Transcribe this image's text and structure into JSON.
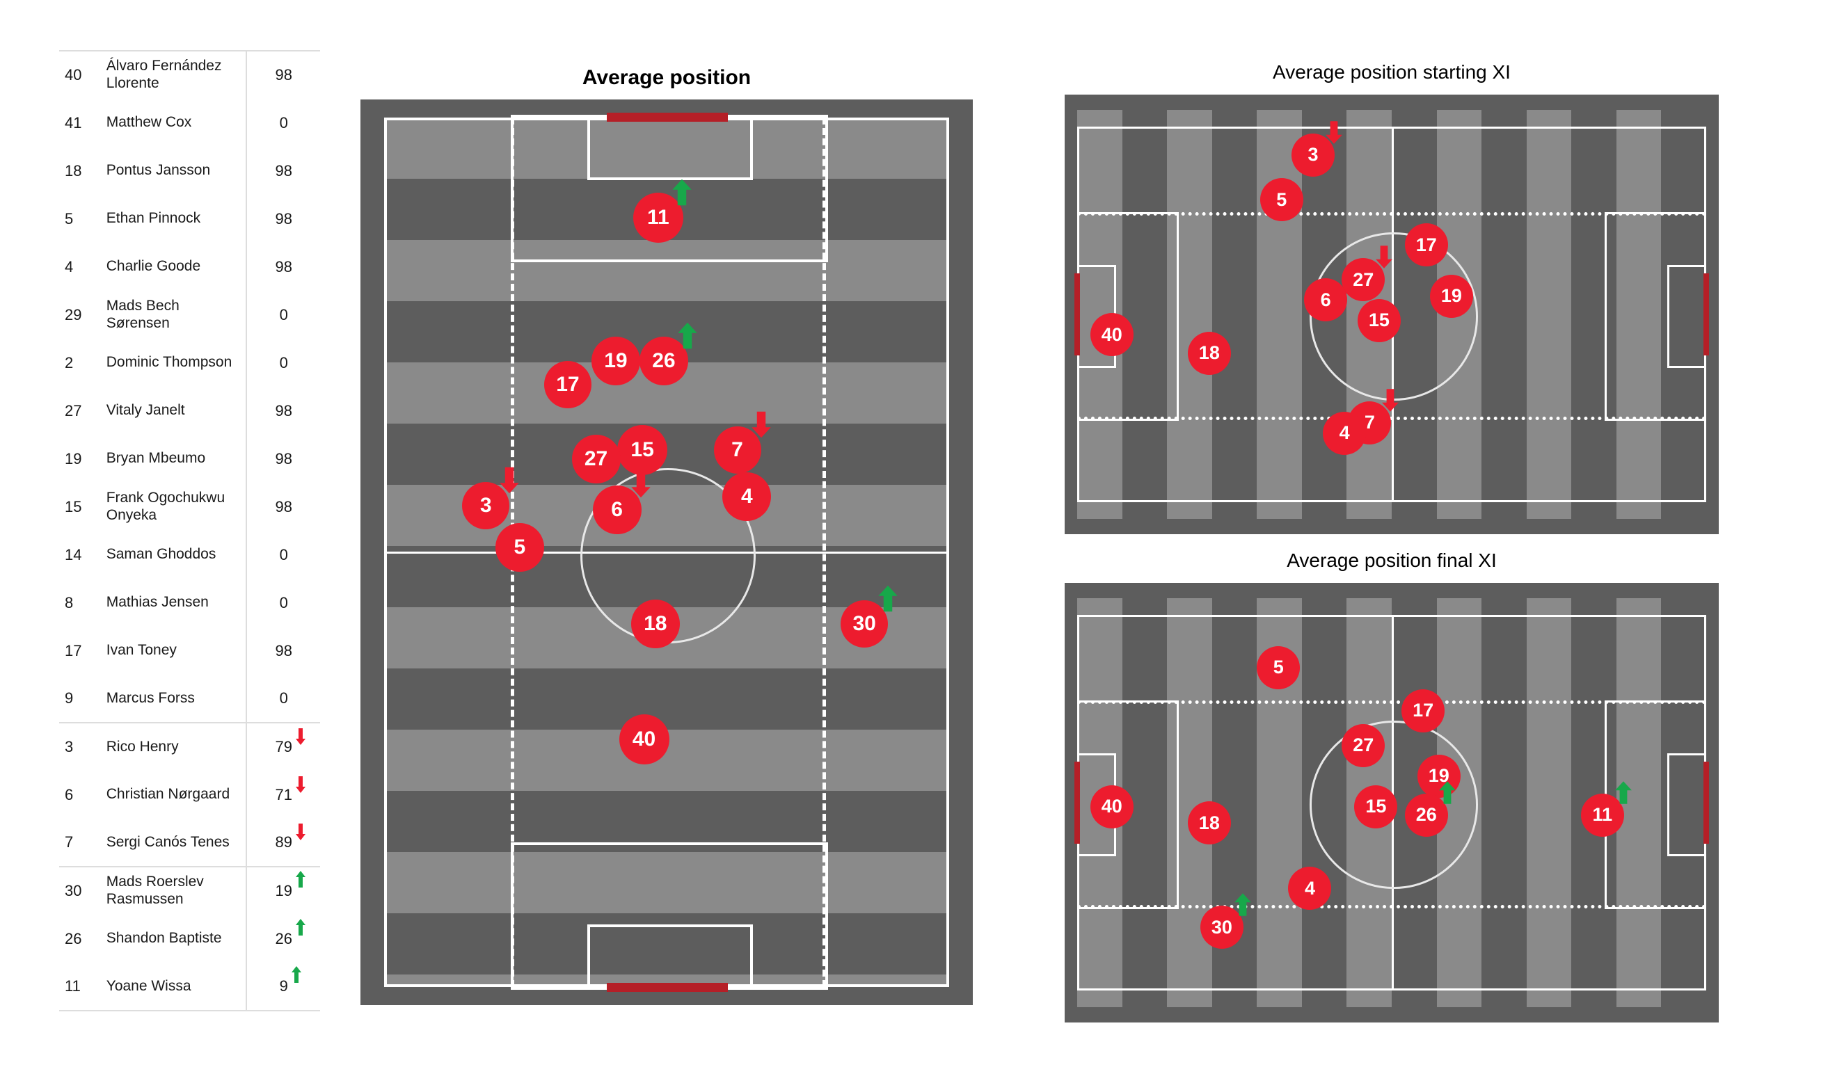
{
  "roster": {
    "columns": [
      "number",
      "player",
      "minutes"
    ],
    "groups": [
      {
        "group": "starters-and-bench",
        "rows": [
          {
            "number": "40",
            "player": "Álvaro Fernández Llorente",
            "value": "98",
            "sub": "none"
          },
          {
            "number": "41",
            "player": "Matthew Cox",
            "value": "0",
            "sub": "none"
          },
          {
            "number": "18",
            "player": "Pontus Jansson",
            "value": "98",
            "sub": "none"
          },
          {
            "number": "5",
            "player": "Ethan Pinnock",
            "value": "98",
            "sub": "none"
          },
          {
            "number": "4",
            "player": "Charlie Goode",
            "value": "98",
            "sub": "none"
          },
          {
            "number": "29",
            "player": "Mads Bech Sørensen",
            "value": "0",
            "sub": "none"
          },
          {
            "number": "2",
            "player": "Dominic Thompson",
            "value": "0",
            "sub": "none"
          },
          {
            "number": "27",
            "player": "Vitaly Janelt",
            "value": "98",
            "sub": "none"
          },
          {
            "number": "19",
            "player": "Bryan Mbeumo",
            "value": "98",
            "sub": "none"
          },
          {
            "number": "15",
            "player": "Frank Ogochukwu Onyeka",
            "value": "98",
            "sub": "none"
          },
          {
            "number": "14",
            "player": "Saman Ghoddos",
            "value": "0",
            "sub": "none"
          },
          {
            "number": "8",
            "player": "Mathias Jensen",
            "value": "0",
            "sub": "none"
          },
          {
            "number": "17",
            "player": "Ivan Toney",
            "value": "98",
            "sub": "none"
          },
          {
            "number": "9",
            "player": "Marcus Forss",
            "value": "0",
            "sub": "none"
          }
        ]
      },
      {
        "group": "subbed-off",
        "rows": [
          {
            "number": "3",
            "player": "Rico Henry",
            "value": "79",
            "sub": "down"
          },
          {
            "number": "6",
            "player": "Christian Nørgaard",
            "value": "71",
            "sub": "down"
          },
          {
            "number": "7",
            "player": "Sergi Canós Tenes",
            "value": "89",
            "sub": "down"
          }
        ]
      },
      {
        "group": "subbed-on",
        "rows": [
          {
            "number": "30",
            "player": "Mads Roerslev Rasmussen",
            "value": "19",
            "sub": "up"
          },
          {
            "number": "26",
            "player": "Shandon Baptiste",
            "value": "26",
            "sub": "up"
          },
          {
            "number": "11",
            "player": "Yoane Wissa",
            "value": "9",
            "sub": "up"
          }
        ]
      }
    ]
  },
  "panels": {
    "main": {
      "title": "Average position"
    },
    "starting": {
      "title": "Average position starting XI"
    },
    "final": {
      "title": "Average position final XI"
    }
  },
  "colors": {
    "marker_red": "#ED1C2E",
    "arrow_green": "#17A84A",
    "arrow_red": "#ED1C2E",
    "goal_red": "#b51f27",
    "pitch_light": "#8a8a8a",
    "pitch_dark": "#5d5d5d",
    "pitch_border": "#5d5d5d",
    "line_white": "#ffffff",
    "table_rule": "#dddddd"
  },
  "chart_data": {
    "type": "scatter",
    "title": "Average position",
    "description": "Football average-position maps. Marker x/y are percentages of the pitch turf area; r is marker radius in px.",
    "pitches": [
      {
        "id": "main",
        "title": "Average position",
        "orientation": "vertical",
        "markers": [
          {
            "number": "11",
            "x": 48.5,
            "y": 11.5,
            "r": 36,
            "arrow": "up"
          },
          {
            "number": "19",
            "x": 41.0,
            "y": 28.0,
            "r": 35,
            "arrow": "none"
          },
          {
            "number": "26",
            "x": 49.5,
            "y": 28.0,
            "r": 35,
            "arrow": "up"
          },
          {
            "number": "17",
            "x": 32.5,
            "y": 30.7,
            "r": 34,
            "arrow": "none"
          },
          {
            "number": "15",
            "x": 45.7,
            "y": 38.2,
            "r": 36,
            "arrow": "none"
          },
          {
            "number": "27",
            "x": 37.5,
            "y": 39.3,
            "r": 35,
            "arrow": "none"
          },
          {
            "number": "7",
            "x": 62.5,
            "y": 38.2,
            "r": 34,
            "arrow": "down"
          },
          {
            "number": "4",
            "x": 64.2,
            "y": 43.6,
            "r": 35,
            "arrow": "none"
          },
          {
            "number": "6",
            "x": 41.2,
            "y": 45.1,
            "r": 35,
            "arrow": "down"
          },
          {
            "number": "3",
            "x": 18.0,
            "y": 44.6,
            "r": 34,
            "arrow": "down"
          },
          {
            "number": "5",
            "x": 24.0,
            "y": 49.4,
            "r": 35,
            "arrow": "none"
          },
          {
            "number": "18",
            "x": 48.0,
            "y": 58.2,
            "r": 35,
            "arrow": "none"
          },
          {
            "number": "30",
            "x": 85.0,
            "y": 58.2,
            "r": 34,
            "arrow": "up"
          },
          {
            "number": "40",
            "x": 46.0,
            "y": 71.5,
            "r": 36,
            "arrow": "none"
          }
        ]
      },
      {
        "id": "starting",
        "title": "Average position starting XI",
        "orientation": "horizontal",
        "markers": [
          {
            "number": "3",
            "x": 37.5,
            "y": 11.0,
            "r": 31,
            "arrow": "down"
          },
          {
            "number": "5",
            "x": 32.5,
            "y": 22.0,
            "r": 31,
            "arrow": "none"
          },
          {
            "number": "17",
            "x": 55.5,
            "y": 33.0,
            "r": 31,
            "arrow": "none"
          },
          {
            "number": "27",
            "x": 45.5,
            "y": 41.5,
            "r": 31,
            "arrow": "down"
          },
          {
            "number": "19",
            "x": 59.5,
            "y": 45.5,
            "r": 31,
            "arrow": "none"
          },
          {
            "number": "6",
            "x": 39.5,
            "y": 46.5,
            "r": 31,
            "arrow": "none"
          },
          {
            "number": "15",
            "x": 48.0,
            "y": 51.5,
            "r": 31,
            "arrow": "none"
          },
          {
            "number": "40",
            "x": 5.5,
            "y": 55.0,
            "r": 31,
            "arrow": "none"
          },
          {
            "number": "18",
            "x": 21.0,
            "y": 59.5,
            "r": 31,
            "arrow": "none"
          },
          {
            "number": "7",
            "x": 46.5,
            "y": 76.5,
            "r": 31,
            "arrow": "down"
          },
          {
            "number": "4",
            "x": 42.5,
            "y": 79.0,
            "r": 31,
            "arrow": "none"
          }
        ]
      },
      {
        "id": "final",
        "title": "Average position final XI",
        "orientation": "horizontal",
        "markers": [
          {
            "number": "5",
            "x": 32.0,
            "y": 17.0,
            "r": 31,
            "arrow": "none"
          },
          {
            "number": "17",
            "x": 55.0,
            "y": 27.5,
            "r": 31,
            "arrow": "none"
          },
          {
            "number": "27",
            "x": 45.5,
            "y": 36.0,
            "r": 31,
            "arrow": "none"
          },
          {
            "number": "19",
            "x": 57.5,
            "y": 43.5,
            "r": 31,
            "arrow": "none"
          },
          {
            "number": "15",
            "x": 47.5,
            "y": 51.0,
            "r": 31,
            "arrow": "none"
          },
          {
            "number": "26",
            "x": 55.5,
            "y": 53.0,
            "r": 31,
            "arrow": "up"
          },
          {
            "number": "40",
            "x": 5.5,
            "y": 51.0,
            "r": 31,
            "arrow": "none"
          },
          {
            "number": "18",
            "x": 21.0,
            "y": 55.0,
            "r": 31,
            "arrow": "none"
          },
          {
            "number": "11",
            "x": 83.5,
            "y": 53.0,
            "r": 31,
            "arrow": "up"
          },
          {
            "number": "4",
            "x": 37.0,
            "y": 71.0,
            "r": 31,
            "arrow": "none"
          },
          {
            "number": "30",
            "x": 23.0,
            "y": 80.5,
            "r": 31,
            "arrow": "up"
          }
        ]
      }
    ]
  }
}
